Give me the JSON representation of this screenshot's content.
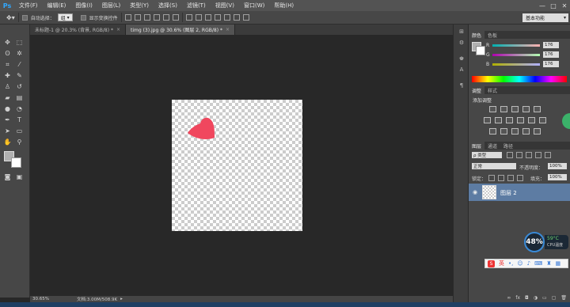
{
  "app": {
    "logo": "Ps"
  },
  "menu": [
    "文件(F)",
    "编辑(E)",
    "图像(I)",
    "图层(L)",
    "类型(Y)",
    "选择(S)",
    "滤镜(T)",
    "视图(V)",
    "窗口(W)",
    "帮助(H)"
  ],
  "window_controls": {
    "minimize": "—",
    "maximize": "□",
    "close": "✕"
  },
  "options": {
    "auto_select_label": "自动选择：",
    "auto_select_value": "组",
    "transform_label": "显示变换控件"
  },
  "workspace": {
    "value": "基本功能"
  },
  "tabs": [
    {
      "label": "未标题-1 @ 20.3% (背景, RGB/8) *",
      "close": "×"
    },
    {
      "label": "timg (3).jpg @ 30.6% (图层 2, RGB/8) *",
      "close": "×"
    }
  ],
  "status": {
    "zoom": "30.65%",
    "doc": "文档:3.00M/508.9K"
  },
  "color_panel": {
    "tabs": [
      "颜色",
      "色板"
    ],
    "channels": [
      {
        "label": "R",
        "value": "176"
      },
      {
        "label": "G",
        "value": "176"
      },
      {
        "label": "B",
        "value": "176"
      }
    ]
  },
  "adjust_panel": {
    "tabs": [
      "调整",
      "样式"
    ],
    "title": "添加调整"
  },
  "layers_panel": {
    "tabs": [
      "图层",
      "通道",
      "路径"
    ],
    "kind_label": "ρ 类型",
    "blend_mode": "正常",
    "opacity_label": "不透明度：",
    "opacity_value": "100%",
    "lock_label": "锁定：",
    "fill_label": "填充：",
    "fill_value": "100%",
    "layers": [
      {
        "name": "图层 2"
      }
    ]
  },
  "monitor": {
    "cpu_percent": "48%",
    "temp": "59°C",
    "label": "CPU温度"
  },
  "ime": {
    "label": "英"
  },
  "colors": {
    "accent": "#31a8ff",
    "heart": "#f0475e",
    "layer_selected": "#5d7ca3"
  }
}
